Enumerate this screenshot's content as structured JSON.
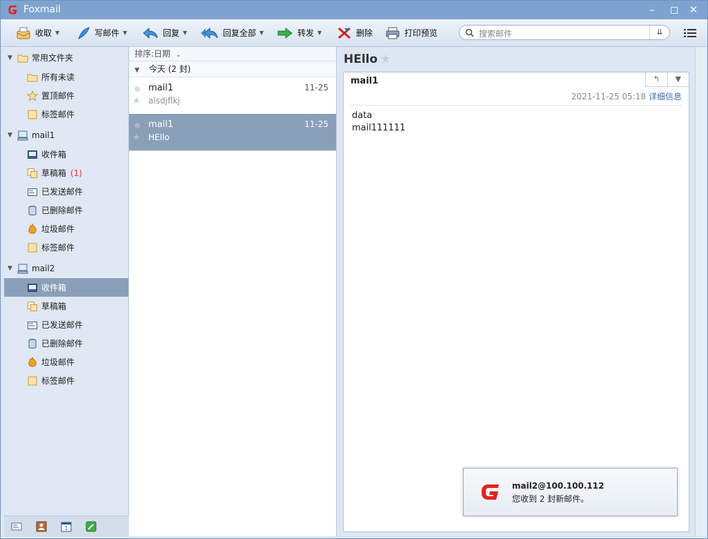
{
  "app": {
    "title": "Foxmail"
  },
  "toolbar": {
    "receive": "收取",
    "compose": "写邮件",
    "reply": "回复",
    "reply_all": "回复全部",
    "forward": "转发",
    "delete": "删除",
    "print_preview": "打印预览",
    "search_placeholder": "搜索邮件"
  },
  "sidebar": {
    "common": {
      "label": "常用文件夹",
      "items": [
        {
          "label": "所有未读",
          "icon": "folder-icon"
        },
        {
          "label": "置顶邮件",
          "icon": "star-icon"
        },
        {
          "label": "标签邮件",
          "icon": "tag-icon"
        }
      ]
    },
    "accounts": [
      {
        "label": "mail1",
        "items": [
          {
            "label": "收件箱",
            "icon": "inbox-icon"
          },
          {
            "label": "草稿箱",
            "icon": "drafts-icon",
            "count": "(1)"
          },
          {
            "label": "已发送邮件",
            "icon": "sent-icon"
          },
          {
            "label": "已删除邮件",
            "icon": "trash-icon"
          },
          {
            "label": "垃圾邮件",
            "icon": "junk-icon"
          },
          {
            "label": "标签邮件",
            "icon": "tag-icon"
          }
        ]
      },
      {
        "label": "mail2",
        "items": [
          {
            "label": "收件箱",
            "icon": "inbox-icon",
            "selected": true
          },
          {
            "label": "草稿箱",
            "icon": "drafts-icon"
          },
          {
            "label": "已发送邮件",
            "icon": "sent-icon"
          },
          {
            "label": "已删除邮件",
            "icon": "trash-icon"
          },
          {
            "label": "垃圾邮件",
            "icon": "junk-icon"
          },
          {
            "label": "标签邮件",
            "icon": "tag-icon"
          }
        ]
      }
    ]
  },
  "list": {
    "sort_label": "排序:日期",
    "group_label": "今天 (2 封)",
    "messages": [
      {
        "from": "mail1",
        "date": "11-25",
        "subject": "alsdjflkj",
        "selected": false
      },
      {
        "from": "mail1",
        "date": "11-25",
        "subject": "HEllo",
        "selected": true
      }
    ]
  },
  "reader": {
    "subject": "HEllo",
    "sender": "mail1",
    "datetime": "2021-11-25 05:18",
    "details_link": "详细信息",
    "body_lines": [
      "data",
      "mail111111"
    ]
  },
  "notification": {
    "account": "mail2@100.100.112",
    "message": "您收到 2 封新邮件。"
  },
  "colors": {
    "accent": "#7ea3cf",
    "selected": "#8aa0b8",
    "logo_red": "#e2231a"
  }
}
